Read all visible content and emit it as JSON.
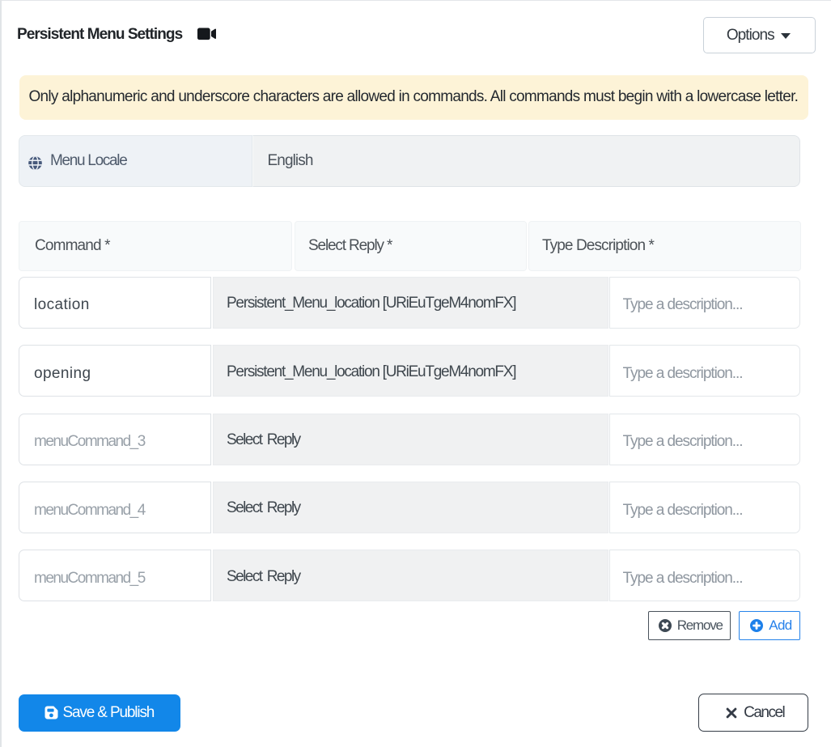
{
  "header": {
    "title": "Persistent Menu Settings",
    "options_button": "Options"
  },
  "alert": {
    "message": "Only alphanumeric and underscore characters are allowed in commands. All commands must begin with a lowercase letter."
  },
  "locale": {
    "label": "Menu Locale",
    "value": "English"
  },
  "commands_table": {
    "headers": {
      "command": "Command *",
      "reply": "Select Reply *",
      "description": "Type Description *"
    },
    "rows": [
      {
        "command_value": "location",
        "reply_value": "Persistent_Menu_location [URiEuTgeM4nomFX]",
        "description_placeholder": "Type a description..."
      },
      {
        "command_value": "opening",
        "reply_value": "Persistent_Menu_location [URiEuTgeM4nomFX]",
        "description_placeholder": "Type a description..."
      },
      {
        "command_placeholder": "menuCommand_3",
        "reply_value": "Select Reply",
        "description_placeholder": "Type a description..."
      },
      {
        "command_placeholder": "menuCommand_4",
        "reply_value": "Select Reply",
        "description_placeholder": "Type a description..."
      },
      {
        "command_placeholder": "menuCommand_5",
        "reply_value": "Select Reply",
        "description_placeholder": "Type a description..."
      }
    ],
    "remove_button": "Remove",
    "add_button": "Add"
  },
  "footer": {
    "save_button": "Save & Publish",
    "cancel_button": "Cancel"
  },
  "colors": {
    "primary_blue": "#1287e9",
    "accent_blue": "#2583ea",
    "alert_background": "#fdf3d7",
    "dark_border": "#343c46",
    "input_disabled_background": "#e9ecef"
  }
}
